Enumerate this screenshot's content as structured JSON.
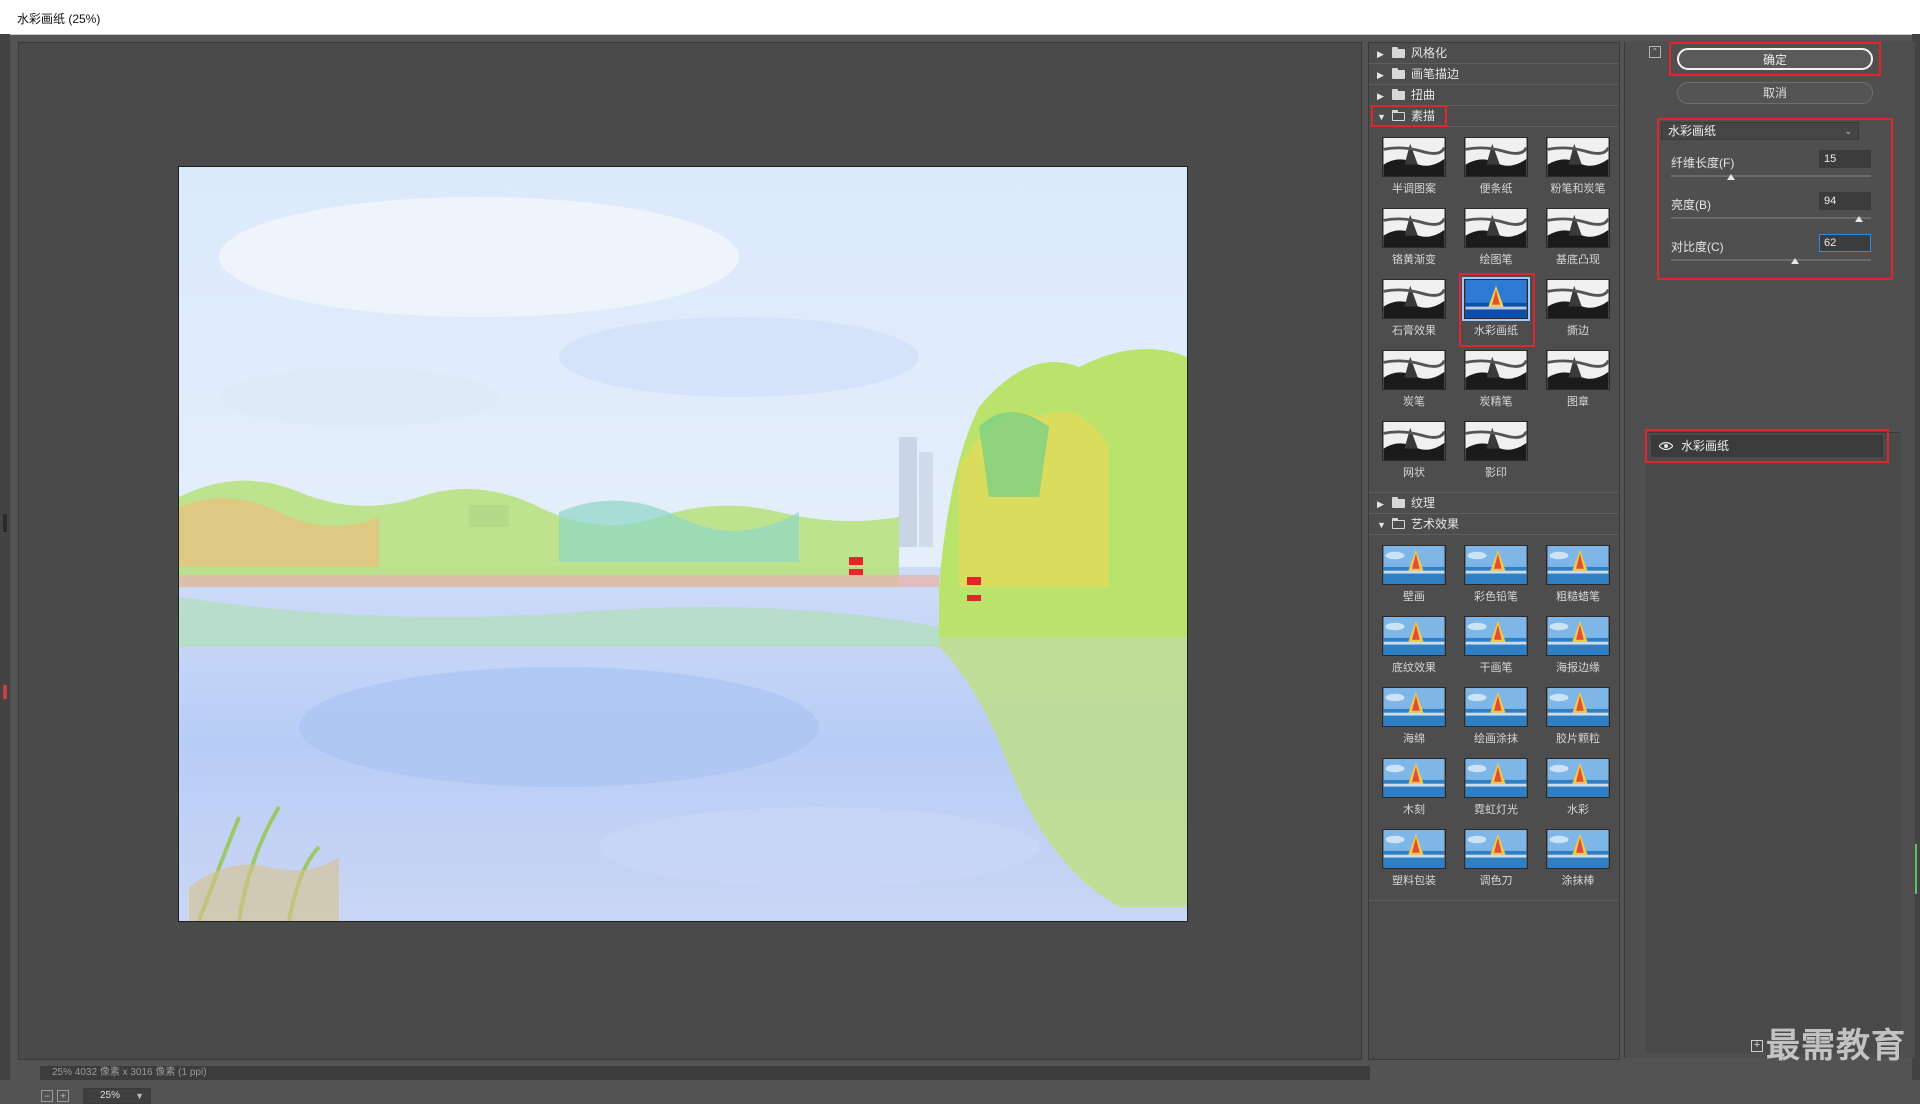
{
  "window": {
    "title": "水彩画纸 (25%)"
  },
  "preview": {
    "zoom": "25%",
    "status": "25%   4032 像素 x 3016 像素 (1 ppi)"
  },
  "gallery": {
    "categories_top": [
      {
        "label": "风格化",
        "expanded": false
      },
      {
        "label": "画笔描边",
        "expanded": false
      },
      {
        "label": "扭曲",
        "expanded": false
      }
    ],
    "sketch": {
      "label": "素描",
      "expanded": true,
      "filters": [
        "半调图案",
        "便条纸",
        "粉笔和炭笔",
        "铬黄渐变",
        "绘图笔",
        "基底凸现",
        "石膏效果",
        "水彩画纸",
        "撕边",
        "炭笔",
        "炭精笔",
        "图章",
        "网状",
        "影印"
      ],
      "selected": "水彩画纸"
    },
    "texture": {
      "label": "纹理",
      "expanded": false
    },
    "artistic": {
      "label": "艺术效果",
      "expanded": true,
      "filters": [
        "壁画",
        "彩色铅笔",
        "粗糙蜡笔",
        "底纹效果",
        "干画笔",
        "海报边缘",
        "海绵",
        "绘画涂抹",
        "胶片颗粒",
        "木刻",
        "霓虹灯光",
        "水彩",
        "塑料包装",
        "调色刀",
        "涂抹棒"
      ]
    }
  },
  "settings": {
    "ok_label": "确定",
    "cancel_label": "取消",
    "filter_select": "水彩画纸",
    "params": [
      {
        "label": "纤维长度(F)",
        "value": "15",
        "fraction": 0.3
      },
      {
        "label": "亮度(B)",
        "value": "94",
        "fraction": 0.94
      },
      {
        "label": "对比度(C)",
        "value": "62",
        "fraction": 0.62
      }
    ],
    "layer_name": "水彩画纸"
  },
  "watermark": "最需教育",
  "colors": {
    "highlight_red": "#e0262b",
    "panel": "#4d4d4d",
    "background": "#535353"
  }
}
